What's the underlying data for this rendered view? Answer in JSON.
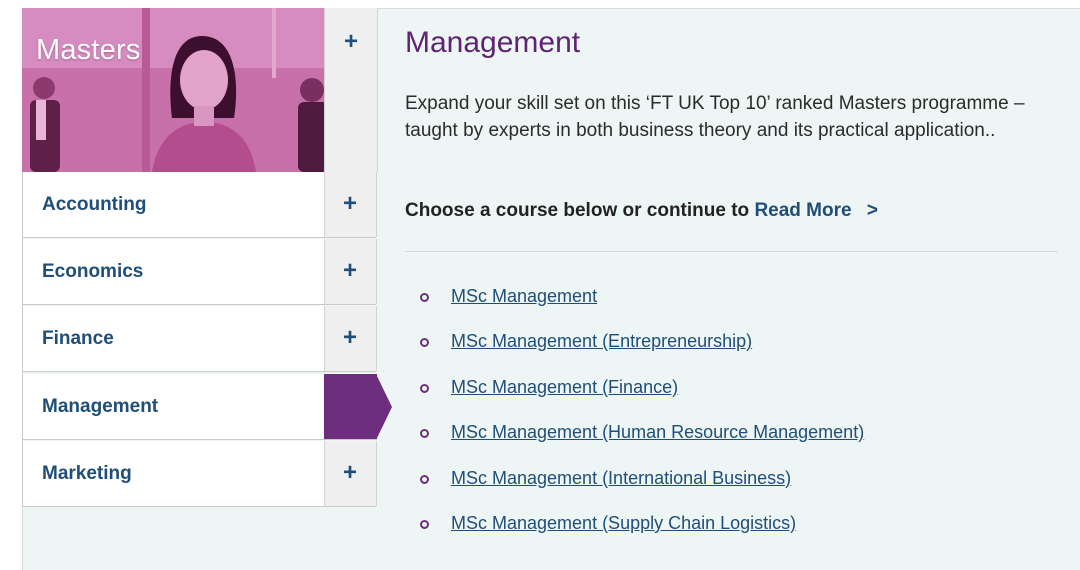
{
  "hero": {
    "title": "Masters",
    "toggle_icon": "+"
  },
  "sidebar": {
    "items": [
      {
        "label": "Accounting",
        "icon": "+",
        "active": false
      },
      {
        "label": "Economics",
        "icon": "+",
        "active": false
      },
      {
        "label": "Finance",
        "icon": "+",
        "active": false
      },
      {
        "label": "Management",
        "icon": "",
        "active": true
      },
      {
        "label": "Marketing",
        "icon": "+",
        "active": false
      }
    ]
  },
  "main": {
    "title": "Management",
    "description": "Expand your skill set on this ‘FT UK Top 10’ ranked Masters programme – taught by experts in both business theory and its practical application..",
    "choose_text": "Choose a course below or continue to",
    "read_more": "Read More",
    "read_more_chevron": ">",
    "courses": [
      "MSc Management",
      "MSc Management (Entrepreneurship)",
      "MSc Management (Finance)",
      "MSc Management (Human Resource Management)",
      "MSc Management (International Business)",
      "MSc Management (Supply Chain Logistics)"
    ]
  },
  "colors": {
    "accent_purple": "#6d2f7d",
    "link_blue": "#1f4e78",
    "panel_bg": "#eef6f5",
    "hero_tint": "#c465a6"
  }
}
